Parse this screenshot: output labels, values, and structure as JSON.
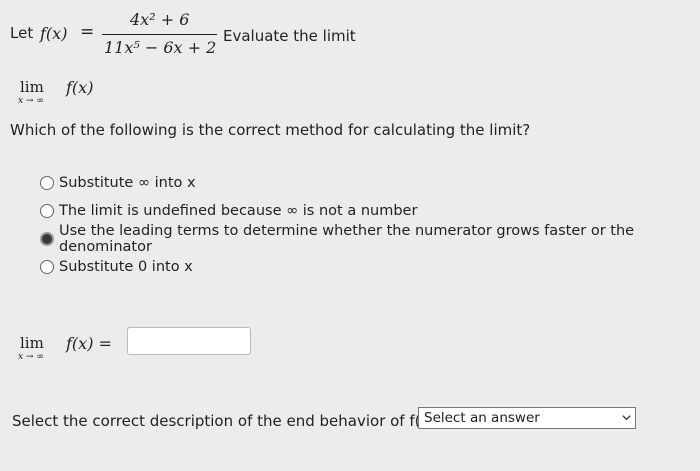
{
  "header": {
    "let_label": "Let",
    "fx": "f(x)",
    "equals": "=",
    "numerator": "4x² + 6",
    "denominator": "11x⁵ − 6x + 2",
    "evaluate": "Evaluate the limit"
  },
  "limit1": {
    "lim": "lim",
    "subscript": "x → ∞",
    "expr": "f(x)"
  },
  "question": "Which of the following is the correct method for calculating the limit?",
  "options": [
    {
      "label": "Substitute ∞ into x",
      "selected": false
    },
    {
      "label": "The limit is undefined because ∞ is not a number",
      "selected": false
    },
    {
      "label": "Use the leading terms to determine whether the numerator grows faster or the denominator",
      "selected": true
    },
    {
      "label": "Substitute 0 into x",
      "selected": false
    }
  ],
  "limit2": {
    "lim": "lim",
    "subscript": "x → ∞",
    "expr": "f(x) =",
    "answer_value": ""
  },
  "end_behavior": {
    "prompt": "Select the correct description of the end behavior of f(x)?",
    "select_value": "Select an answer",
    "chevron_icon": "chevron-down-icon"
  }
}
